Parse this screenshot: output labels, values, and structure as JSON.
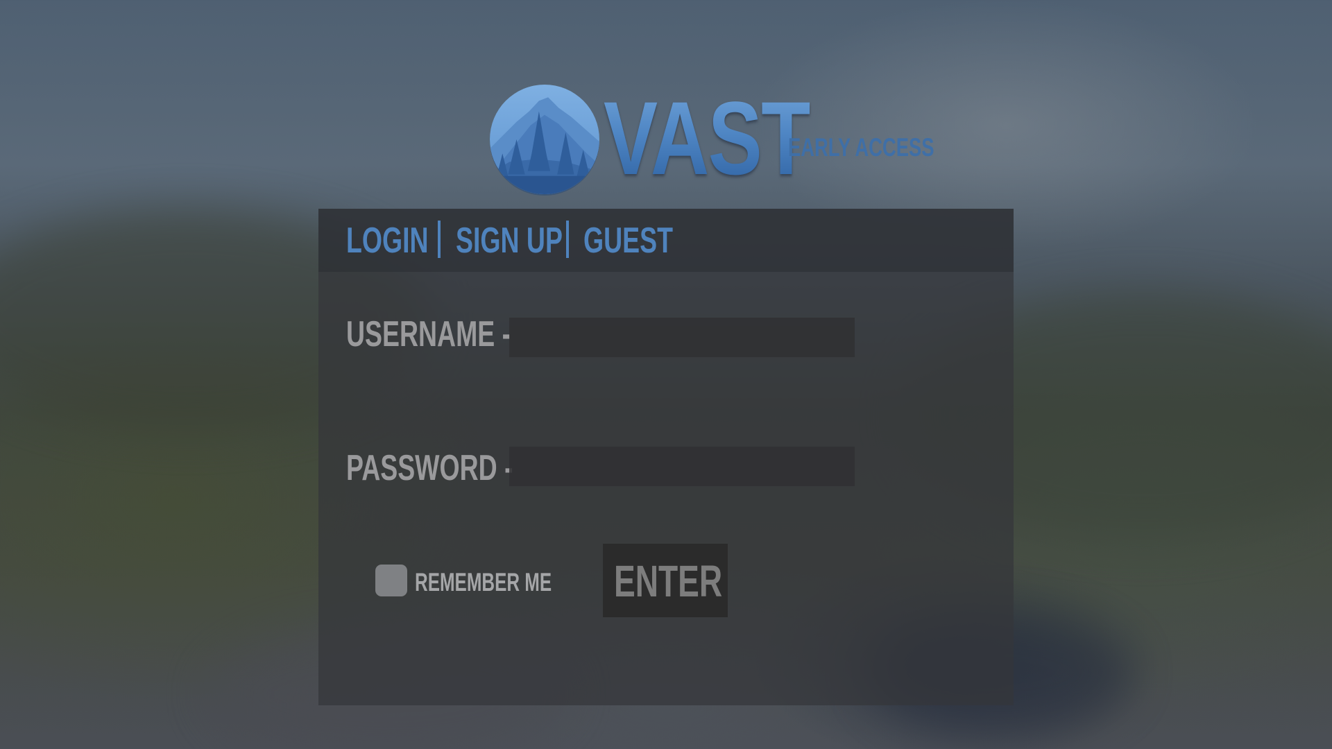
{
  "logo": {
    "wordmark": "VAST",
    "tagline": "EARLY ACCESS",
    "emblem_icon": "mountain-forest-icon"
  },
  "tabs": [
    {
      "label": "LOGIN",
      "active": true
    },
    {
      "label": "SIGN UP",
      "active": false
    },
    {
      "label": "GUEST",
      "active": false
    }
  ],
  "form": {
    "username_label": "USERNAME -",
    "username_value": "",
    "password_label": "PASSWORD -",
    "password_value": "",
    "remember_label": "REMEMBER ME",
    "remember_checked": false,
    "enter_label": "ENTER"
  },
  "colors": {
    "accent": "#4f83bd",
    "label_gray": "#9a9a9c",
    "panel_bg": "#34363a"
  }
}
